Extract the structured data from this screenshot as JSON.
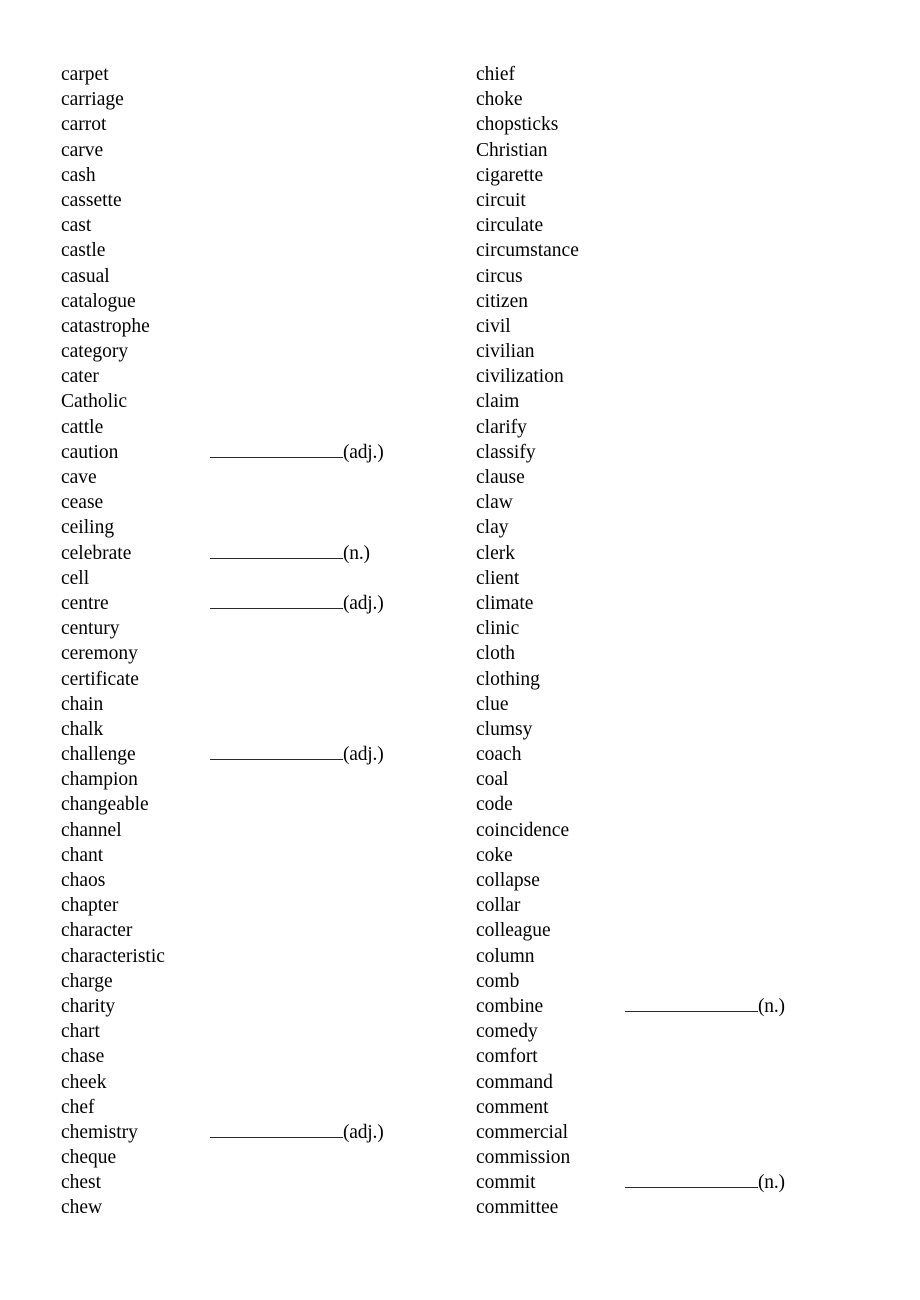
{
  "document": {
    "type": "vocabulary-word-list-worksheet",
    "background_color": "#ffffff",
    "text_color": "#000000",
    "rule_color": "#2b2b2b"
  },
  "columns": [
    {
      "id": "left",
      "entries": [
        {
          "word": "carpet",
          "tag": ""
        },
        {
          "word": "carriage",
          "tag": ""
        },
        {
          "word": "carrot",
          "tag": ""
        },
        {
          "word": "carve",
          "tag": ""
        },
        {
          "word": "cash",
          "tag": ""
        },
        {
          "word": "cassette",
          "tag": ""
        },
        {
          "word": "cast",
          "tag": ""
        },
        {
          "word": "castle",
          "tag": ""
        },
        {
          "word": "casual",
          "tag": ""
        },
        {
          "word": "catalogue",
          "tag": ""
        },
        {
          "word": "catastrophe",
          "tag": ""
        },
        {
          "word": "category",
          "tag": ""
        },
        {
          "word": "cater",
          "tag": ""
        },
        {
          "word": "Catholic",
          "tag": ""
        },
        {
          "word": "cattle",
          "tag": ""
        },
        {
          "word": "caution",
          "tag": "(adj.)"
        },
        {
          "word": "cave",
          "tag": ""
        },
        {
          "word": "cease",
          "tag": ""
        },
        {
          "word": "ceiling",
          "tag": ""
        },
        {
          "word": "celebrate",
          "tag": "(n.)"
        },
        {
          "word": "cell",
          "tag": ""
        },
        {
          "word": "centre",
          "tag": "(adj.)"
        },
        {
          "word": "century",
          "tag": ""
        },
        {
          "word": "ceremony",
          "tag": ""
        },
        {
          "word": "certificate",
          "tag": ""
        },
        {
          "word": "chain",
          "tag": ""
        },
        {
          "word": "chalk",
          "tag": ""
        },
        {
          "word": "challenge",
          "tag": "(adj.)"
        },
        {
          "word": "champion",
          "tag": ""
        },
        {
          "word": "changeable",
          "tag": ""
        },
        {
          "word": "channel",
          "tag": ""
        },
        {
          "word": "chant",
          "tag": ""
        },
        {
          "word": "chaos",
          "tag": ""
        },
        {
          "word": "chapter",
          "tag": ""
        },
        {
          "word": "character",
          "tag": ""
        },
        {
          "word": "characteristic",
          "tag": ""
        },
        {
          "word": "charge",
          "tag": ""
        },
        {
          "word": "charity",
          "tag": ""
        },
        {
          "word": "chart",
          "tag": ""
        },
        {
          "word": "chase",
          "tag": ""
        },
        {
          "word": "cheek",
          "tag": ""
        },
        {
          "word": "chef",
          "tag": ""
        },
        {
          "word": "chemistry",
          "tag": "(adj.)"
        },
        {
          "word": "cheque",
          "tag": ""
        },
        {
          "word": "chest",
          "tag": ""
        },
        {
          "word": "chew",
          "tag": ""
        }
      ]
    },
    {
      "id": "right",
      "entries": [
        {
          "word": "chief",
          "tag": ""
        },
        {
          "word": "choke",
          "tag": ""
        },
        {
          "word": "chopsticks",
          "tag": ""
        },
        {
          "word": "Christian",
          "tag": ""
        },
        {
          "word": "cigarette",
          "tag": ""
        },
        {
          "word": "circuit",
          "tag": ""
        },
        {
          "word": "circulate",
          "tag": ""
        },
        {
          "word": "circumstance",
          "tag": ""
        },
        {
          "word": "circus",
          "tag": ""
        },
        {
          "word": "citizen",
          "tag": ""
        },
        {
          "word": "civil",
          "tag": ""
        },
        {
          "word": "civilian",
          "tag": ""
        },
        {
          "word": "civilization",
          "tag": ""
        },
        {
          "word": "claim",
          "tag": ""
        },
        {
          "word": "clarify",
          "tag": ""
        },
        {
          "word": "classify",
          "tag": ""
        },
        {
          "word": "clause",
          "tag": ""
        },
        {
          "word": "claw",
          "tag": ""
        },
        {
          "word": "clay",
          "tag": ""
        },
        {
          "word": "clerk",
          "tag": ""
        },
        {
          "word": "client",
          "tag": ""
        },
        {
          "word": "climate",
          "tag": ""
        },
        {
          "word": "clinic",
          "tag": ""
        },
        {
          "word": "cloth",
          "tag": ""
        },
        {
          "word": "clothing",
          "tag": ""
        },
        {
          "word": "clue",
          "tag": ""
        },
        {
          "word": "clumsy",
          "tag": ""
        },
        {
          "word": "coach",
          "tag": ""
        },
        {
          "word": "coal",
          "tag": ""
        },
        {
          "word": "code",
          "tag": ""
        },
        {
          "word": "coincidence",
          "tag": ""
        },
        {
          "word": "coke",
          "tag": ""
        },
        {
          "word": "collapse",
          "tag": ""
        },
        {
          "word": "collar",
          "tag": ""
        },
        {
          "word": "colleague",
          "tag": ""
        },
        {
          "word": "column",
          "tag": ""
        },
        {
          "word": "comb",
          "tag": ""
        },
        {
          "word": "combine",
          "tag": "(n.)"
        },
        {
          "word": "comedy",
          "tag": ""
        },
        {
          "word": "comfort",
          "tag": ""
        },
        {
          "word": "command",
          "tag": ""
        },
        {
          "word": "comment",
          "tag": ""
        },
        {
          "word": "commercial",
          "tag": ""
        },
        {
          "word": "commission",
          "tag": ""
        },
        {
          "word": "commit",
          "tag": "(n.)"
        },
        {
          "word": "committee",
          "tag": ""
        }
      ]
    }
  ]
}
